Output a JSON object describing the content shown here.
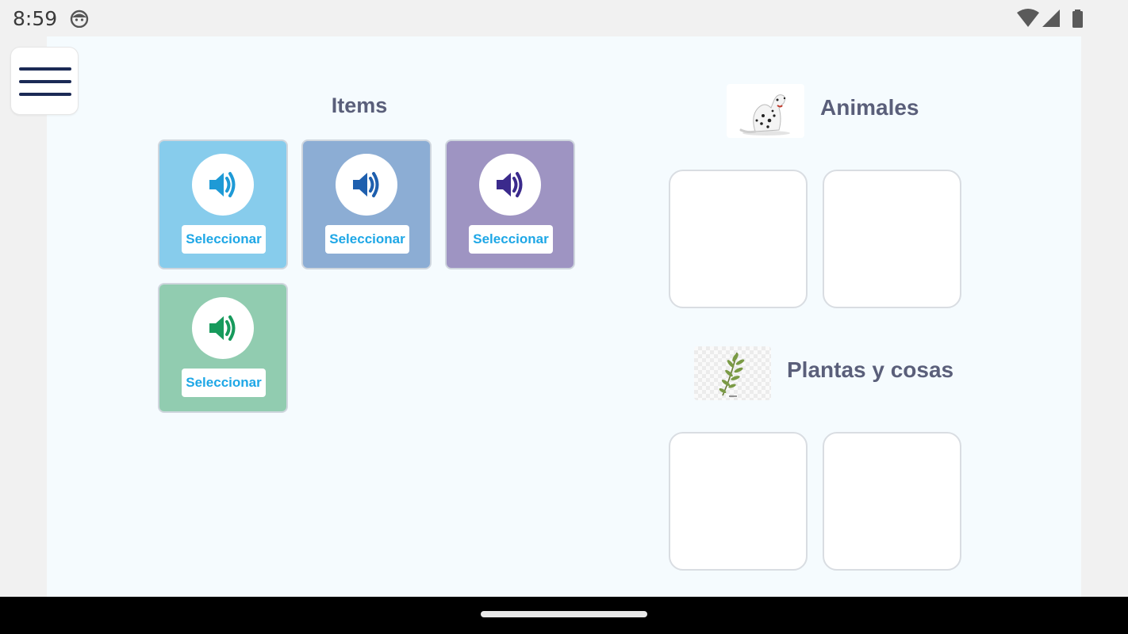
{
  "status": {
    "time": "8:59"
  },
  "items_panel": {
    "title": "Items",
    "tiles": [
      {
        "select_label": "Seleccionar",
        "bg": "#87ccec",
        "icon_color": "#1e9ad6"
      },
      {
        "select_label": "Seleccionar",
        "bg": "#8cadd4",
        "icon_color": "#1e5fae"
      },
      {
        "select_label": "Seleccionar",
        "bg": "#9e94c2",
        "icon_color": "#3b2a8c"
      },
      {
        "select_label": "Seleccionar",
        "bg": "#91ccb0",
        "icon_color": "#179a5c"
      }
    ]
  },
  "categories": [
    {
      "name": "Animales",
      "image": "dalmatian-dog"
    },
    {
      "name": "Plantas y cosas",
      "image": "plant-sprig"
    }
  ],
  "colors": {
    "accent": "#1ea7e6",
    "title": "#5a5f7a",
    "menu": "#1b2a55"
  }
}
